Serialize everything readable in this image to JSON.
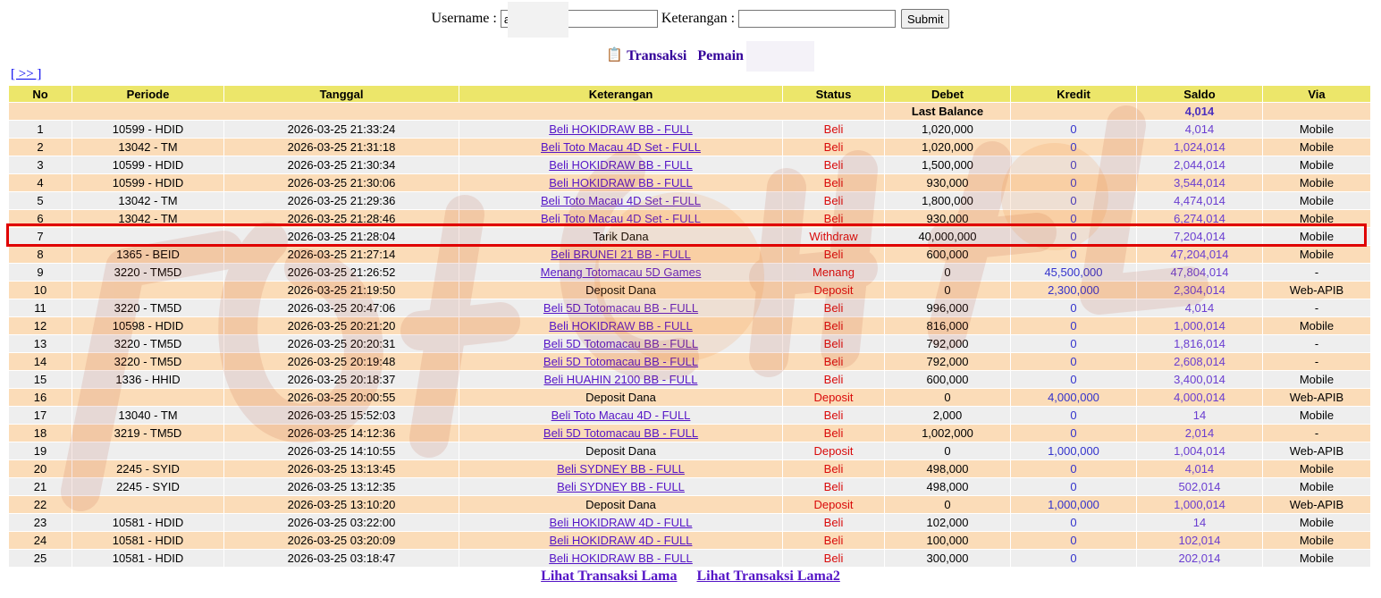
{
  "search": {
    "username_label": "Username :",
    "username_value": "a",
    "keterangan_label": "Keterangan :",
    "keterangan_value": "",
    "submit_label": "Submit"
  },
  "title": {
    "transaksi": "Transaksi",
    "pemain_label": "Pemain : am"
  },
  "nav": {
    "next_label": "[ >> ]"
  },
  "columns": [
    "No",
    "Periode",
    "Tanggal",
    "Keterangan",
    "Status",
    "Debet",
    "Kredit",
    "Saldo",
    "Via"
  ],
  "last_balance": {
    "label": "Last Balance",
    "value": "4,014"
  },
  "rows": [
    {
      "no": "1",
      "periode": "10599 - HDID",
      "tanggal": "2026-03-25 21:33:24",
      "keterangan": "Beli HOKIDRAW BB - FULL",
      "link": true,
      "status": "Beli",
      "debet": "1,020,000",
      "kredit": "0",
      "saldo": "4,014",
      "via": "Mobile"
    },
    {
      "no": "2",
      "periode": "13042 - TM",
      "tanggal": "2026-03-25 21:31:18",
      "keterangan": "Beli Toto Macau 4D Set - FULL",
      "link": true,
      "status": "Beli",
      "debet": "1,020,000",
      "kredit": "0",
      "saldo": "1,024,014",
      "via": "Mobile"
    },
    {
      "no": "3",
      "periode": "10599 - HDID",
      "tanggal": "2026-03-25 21:30:34",
      "keterangan": "Beli HOKIDRAW BB - FULL",
      "link": true,
      "status": "Beli",
      "debet": "1,500,000",
      "kredit": "0",
      "saldo": "2,044,014",
      "via": "Mobile"
    },
    {
      "no": "4",
      "periode": "10599 - HDID",
      "tanggal": "2026-03-25 21:30:06",
      "keterangan": "Beli HOKIDRAW BB - FULL",
      "link": true,
      "status": "Beli",
      "debet": "930,000",
      "kredit": "0",
      "saldo": "3,544,014",
      "via": "Mobile"
    },
    {
      "no": "5",
      "periode": "13042 - TM",
      "tanggal": "2026-03-25 21:29:36",
      "keterangan": "Beli Toto Macau 4D Set - FULL",
      "link": true,
      "status": "Beli",
      "debet": "1,800,000",
      "kredit": "0",
      "saldo": "4,474,014",
      "via": "Mobile"
    },
    {
      "no": "6",
      "periode": "13042 - TM",
      "tanggal": "2026-03-25 21:28:46",
      "keterangan": "Beli Toto Macau 4D Set - FULL",
      "link": true,
      "status": "Beli",
      "debet": "930,000",
      "kredit": "0",
      "saldo": "6,274,014",
      "via": "Mobile"
    },
    {
      "no": "7",
      "periode": "",
      "tanggal": "2026-03-25 21:28:04",
      "keterangan": "Tarik Dana",
      "link": false,
      "status": "Withdraw",
      "debet": "40,000,000",
      "kredit": "0",
      "saldo": "7,204,014",
      "via": "Mobile"
    },
    {
      "no": "8",
      "periode": "1365 - BEID",
      "tanggal": "2026-03-25 21:27:14",
      "keterangan": "Beli BRUNEI 21 BB - FULL",
      "link": true,
      "status": "Beli",
      "debet": "600,000",
      "kredit": "0",
      "saldo": "47,204,014",
      "via": "Mobile"
    },
    {
      "no": "9",
      "periode": "3220 - TM5D",
      "tanggal": "2026-03-25 21:26:52",
      "keterangan": "Menang Totomacau 5D Games",
      "link": true,
      "status": "Menang",
      "debet": "0",
      "kredit": "45,500,000",
      "saldo": "47,804,014",
      "via": "-"
    },
    {
      "no": "10",
      "periode": "",
      "tanggal": "2026-03-25 21:19:50",
      "keterangan": "Deposit Dana",
      "link": false,
      "status": "Deposit",
      "debet": "0",
      "kredit": "2,300,000",
      "saldo": "2,304,014",
      "via": "Web-APIB"
    },
    {
      "no": "11",
      "periode": "3220 - TM5D",
      "tanggal": "2026-03-25 20:47:06",
      "keterangan": "Beli 5D Totomacau BB - FULL",
      "link": true,
      "status": "Beli",
      "debet": "996,000",
      "kredit": "0",
      "saldo": "4,014",
      "via": "-"
    },
    {
      "no": "12",
      "periode": "10598 - HDID",
      "tanggal": "2026-03-25 20:21:20",
      "keterangan": "Beli HOKIDRAW BB - FULL",
      "link": true,
      "status": "Beli",
      "debet": "816,000",
      "kredit": "0",
      "saldo": "1,000,014",
      "via": "Mobile"
    },
    {
      "no": "13",
      "periode": "3220 - TM5D",
      "tanggal": "2026-03-25 20:20:31",
      "keterangan": "Beli 5D Totomacau BB - FULL",
      "link": true,
      "status": "Beli",
      "debet": "792,000",
      "kredit": "0",
      "saldo": "1,816,014",
      "via": "-"
    },
    {
      "no": "14",
      "periode": "3220 - TM5D",
      "tanggal": "2026-03-25 20:19:48",
      "keterangan": "Beli 5D Totomacau BB - FULL",
      "link": true,
      "status": "Beli",
      "debet": "792,000",
      "kredit": "0",
      "saldo": "2,608,014",
      "via": "-"
    },
    {
      "no": "15",
      "periode": "1336 - HHID",
      "tanggal": "2026-03-25 20:18:37",
      "keterangan": "Beli HUAHIN 2100 BB - FULL",
      "link": true,
      "status": "Beli",
      "debet": "600,000",
      "kredit": "0",
      "saldo": "3,400,014",
      "via": "Mobile"
    },
    {
      "no": "16",
      "periode": "",
      "tanggal": "2026-03-25 20:00:55",
      "keterangan": "Deposit Dana",
      "link": false,
      "status": "Deposit",
      "debet": "0",
      "kredit": "4,000,000",
      "saldo": "4,000,014",
      "via": "Web-APIB"
    },
    {
      "no": "17",
      "periode": "13040 - TM",
      "tanggal": "2026-03-25 15:52:03",
      "keterangan": "Beli Toto Macau 4D - FULL",
      "link": true,
      "status": "Beli",
      "debet": "2,000",
      "kredit": "0",
      "saldo": "14",
      "via": "Mobile"
    },
    {
      "no": "18",
      "periode": "3219 - TM5D",
      "tanggal": "2026-03-25 14:12:36",
      "keterangan": "Beli 5D Totomacau BB - FULL",
      "link": true,
      "status": "Beli",
      "debet": "1,002,000",
      "kredit": "0",
      "saldo": "2,014",
      "via": "-"
    },
    {
      "no": "19",
      "periode": "",
      "tanggal": "2026-03-25 14:10:55",
      "keterangan": "Deposit Dana",
      "link": false,
      "status": "Deposit",
      "debet": "0",
      "kredit": "1,000,000",
      "saldo": "1,004,014",
      "via": "Web-APIB"
    },
    {
      "no": "20",
      "periode": "2245 - SYID",
      "tanggal": "2026-03-25 13:13:45",
      "keterangan": "Beli SYDNEY BB - FULL",
      "link": true,
      "status": "Beli",
      "debet": "498,000",
      "kredit": "0",
      "saldo": "4,014",
      "via": "Mobile"
    },
    {
      "no": "21",
      "periode": "2245 - SYID",
      "tanggal": "2026-03-25 13:12:35",
      "keterangan": "Beli SYDNEY BB - FULL",
      "link": true,
      "status": "Beli",
      "debet": "498,000",
      "kredit": "0",
      "saldo": "502,014",
      "via": "Mobile"
    },
    {
      "no": "22",
      "periode": "",
      "tanggal": "2026-03-25 13:10:20",
      "keterangan": "Deposit Dana",
      "link": false,
      "status": "Deposit",
      "debet": "0",
      "kredit": "1,000,000",
      "saldo": "1,000,014",
      "via": "Web-APIB"
    },
    {
      "no": "23",
      "periode": "10581 - HDID",
      "tanggal": "2026-03-25 03:22:00",
      "keterangan": "Beli HOKIDRAW 4D - FULL",
      "link": true,
      "status": "Beli",
      "debet": "102,000",
      "kredit": "0",
      "saldo": "14",
      "via": "Mobile"
    },
    {
      "no": "24",
      "periode": "10581 - HDID",
      "tanggal": "2026-03-25 03:20:09",
      "keterangan": "Beli HOKIDRAW 4D - FULL",
      "link": true,
      "status": "Beli",
      "debet": "100,000",
      "kredit": "0",
      "saldo": "102,014",
      "via": "Mobile"
    },
    {
      "no": "25",
      "periode": "10581 - HDID",
      "tanggal": "2026-03-25 03:18:47",
      "keterangan": "Beli HOKIDRAW BB - FULL",
      "link": true,
      "status": "Beli",
      "debet": "300,000",
      "kredit": "0",
      "saldo": "202,014",
      "via": "Mobile"
    }
  ],
  "footer": {
    "link_lama": "Lihat Transaksi Lama",
    "link_lama2": "Lihat Transaksi Lama2"
  },
  "colors": {
    "header_bg": "#ece66a",
    "row_even": "#eeeeee",
    "row_odd": "#fbdcb8",
    "status_red": "#d90a0a",
    "link_purple": "#5515c7",
    "kredit_blue": "#3333cc",
    "saldo_purple": "#6a3ed1",
    "highlight_red": "#e00000"
  },
  "highlighted_row_no": "7",
  "icons": {
    "title_icon": "clipboard-icon"
  }
}
